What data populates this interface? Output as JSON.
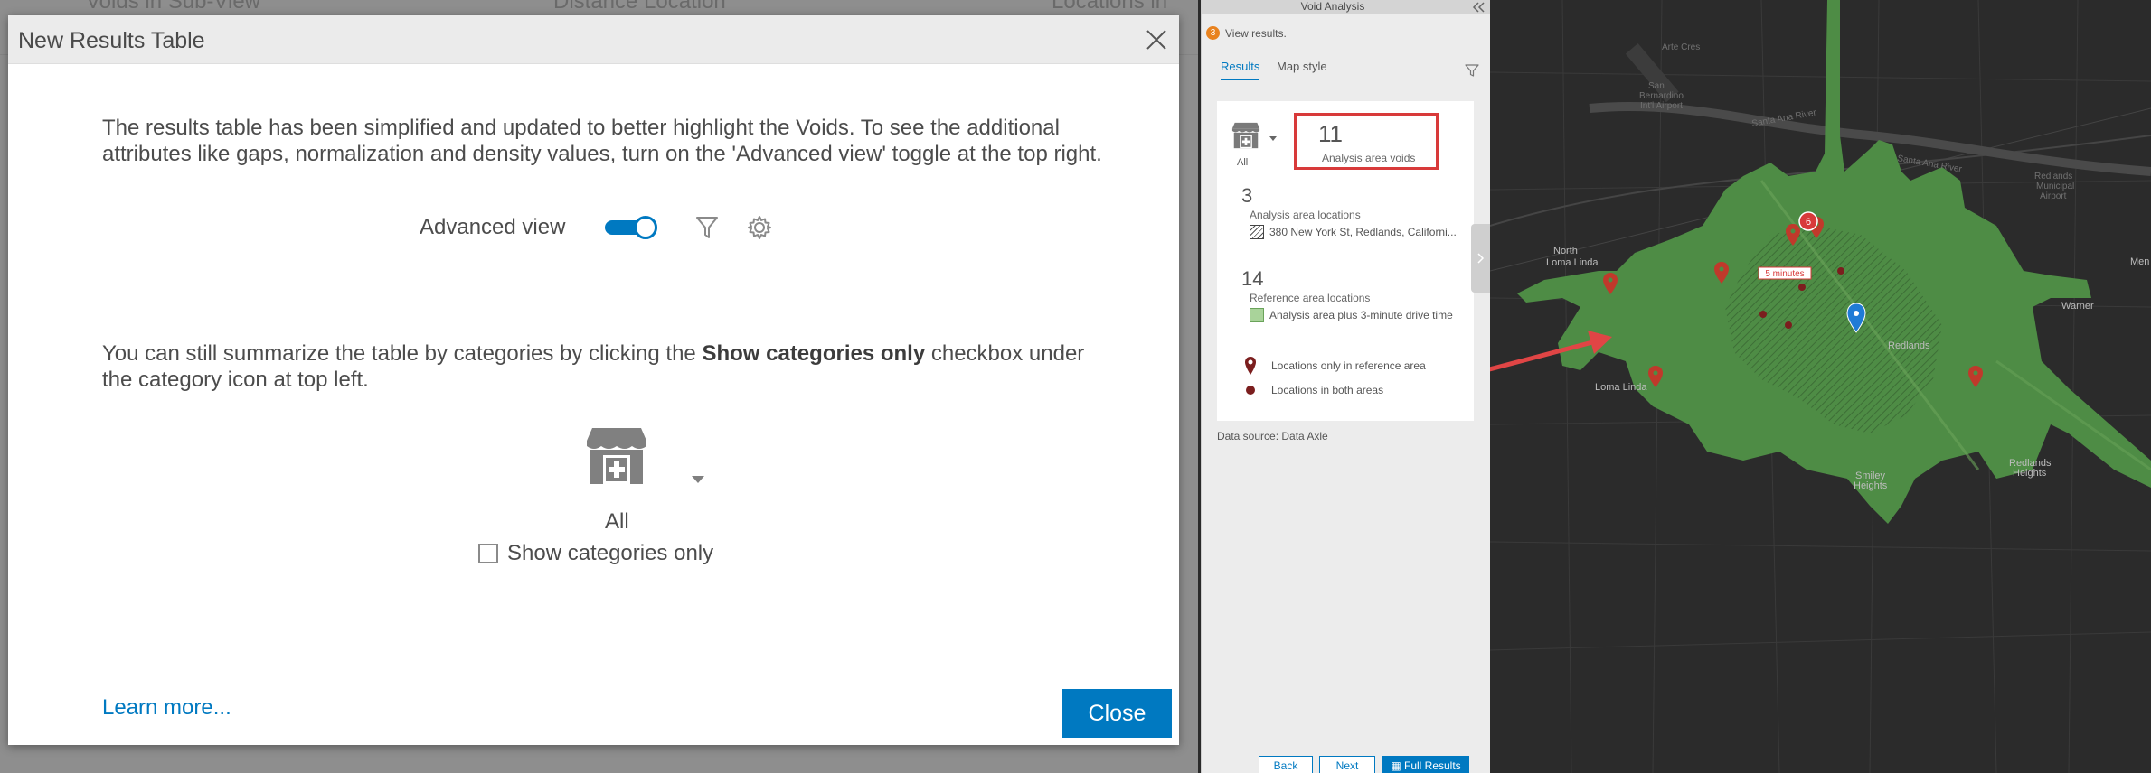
{
  "background": {
    "ghost_texts": [
      "Voids in Sub-View",
      "Distance Location",
      "Locations in"
    ]
  },
  "modal": {
    "title": "New Results Table",
    "intro_text": "The results table has been simplified and updated to better highlight the Voids. To see the additional attributes like gaps, normalization and density values, turn on the 'Advanced view' toggle at the top right.",
    "advanced_view_label": "Advanced view",
    "advanced_view_on": true,
    "summary_text_before": "You can still summarize the table by categories by clicking the ",
    "summary_text_bold": "Show categories only",
    "summary_text_after": " checkbox under the category icon at top left.",
    "category_all": "All",
    "show_categories_label": "Show categories only",
    "show_categories_checked": false,
    "learn_more": "Learn more...",
    "close_label": "Close"
  },
  "panel": {
    "title": "Void Analysis",
    "step_number": "3",
    "step_text": "View results.",
    "tabs": [
      {
        "label": "Results",
        "active": true
      },
      {
        "label": "Map style",
        "active": false
      }
    ],
    "category_all": "All",
    "voids_count": "11",
    "voids_label": "Analysis area voids",
    "analysis_count": "3",
    "analysis_label": "Analysis area locations",
    "analysis_sub": "380 New York St, Redlands, Californi...",
    "reference_count": "14",
    "reference_label": "Reference area locations",
    "reference_sub": "Analysis area plus 3-minute drive time",
    "legend_ref": "Locations only in reference area",
    "legend_both": "Locations in both areas",
    "data_source": "Data source:  Data Axle",
    "buttons": {
      "back": "Back",
      "next": "Next",
      "full_results": "Full Results"
    }
  },
  "map": {
    "labels": {
      "north_loma_linda_1": "North",
      "north_loma_linda_2": "Loma Linda",
      "loma_linda": "Loma Linda",
      "redlands": "Redlands",
      "warner": "Warner",
      "smiley_1": "Smiley",
      "smiley_2": "Heights",
      "redlands_heights_1": "Redlands",
      "redlands_heights_2": "Heights",
      "airport_1": "Redlands",
      "airport_2": "Municipal",
      "airport_3": "Airport",
      "men": "Men",
      "cluster_count": "6",
      "drive_time_tag": "5 minutes",
      "san_bernardino_1": "San",
      "san_bernardino_2": "Bernardino",
      "san_bernardino_3": "Int'l Airport",
      "santa_ana_1": "Santa Ana River",
      "santa_ana_2": "Santa Ana River",
      "tag_top": "Arte Cres"
    }
  },
  "colors": {
    "accent": "#0079c1",
    "highlight_box": "#d83a3a",
    "step_badge": "#e8821e",
    "map_green": "#4e8c45",
    "marker": "#c0392b"
  }
}
